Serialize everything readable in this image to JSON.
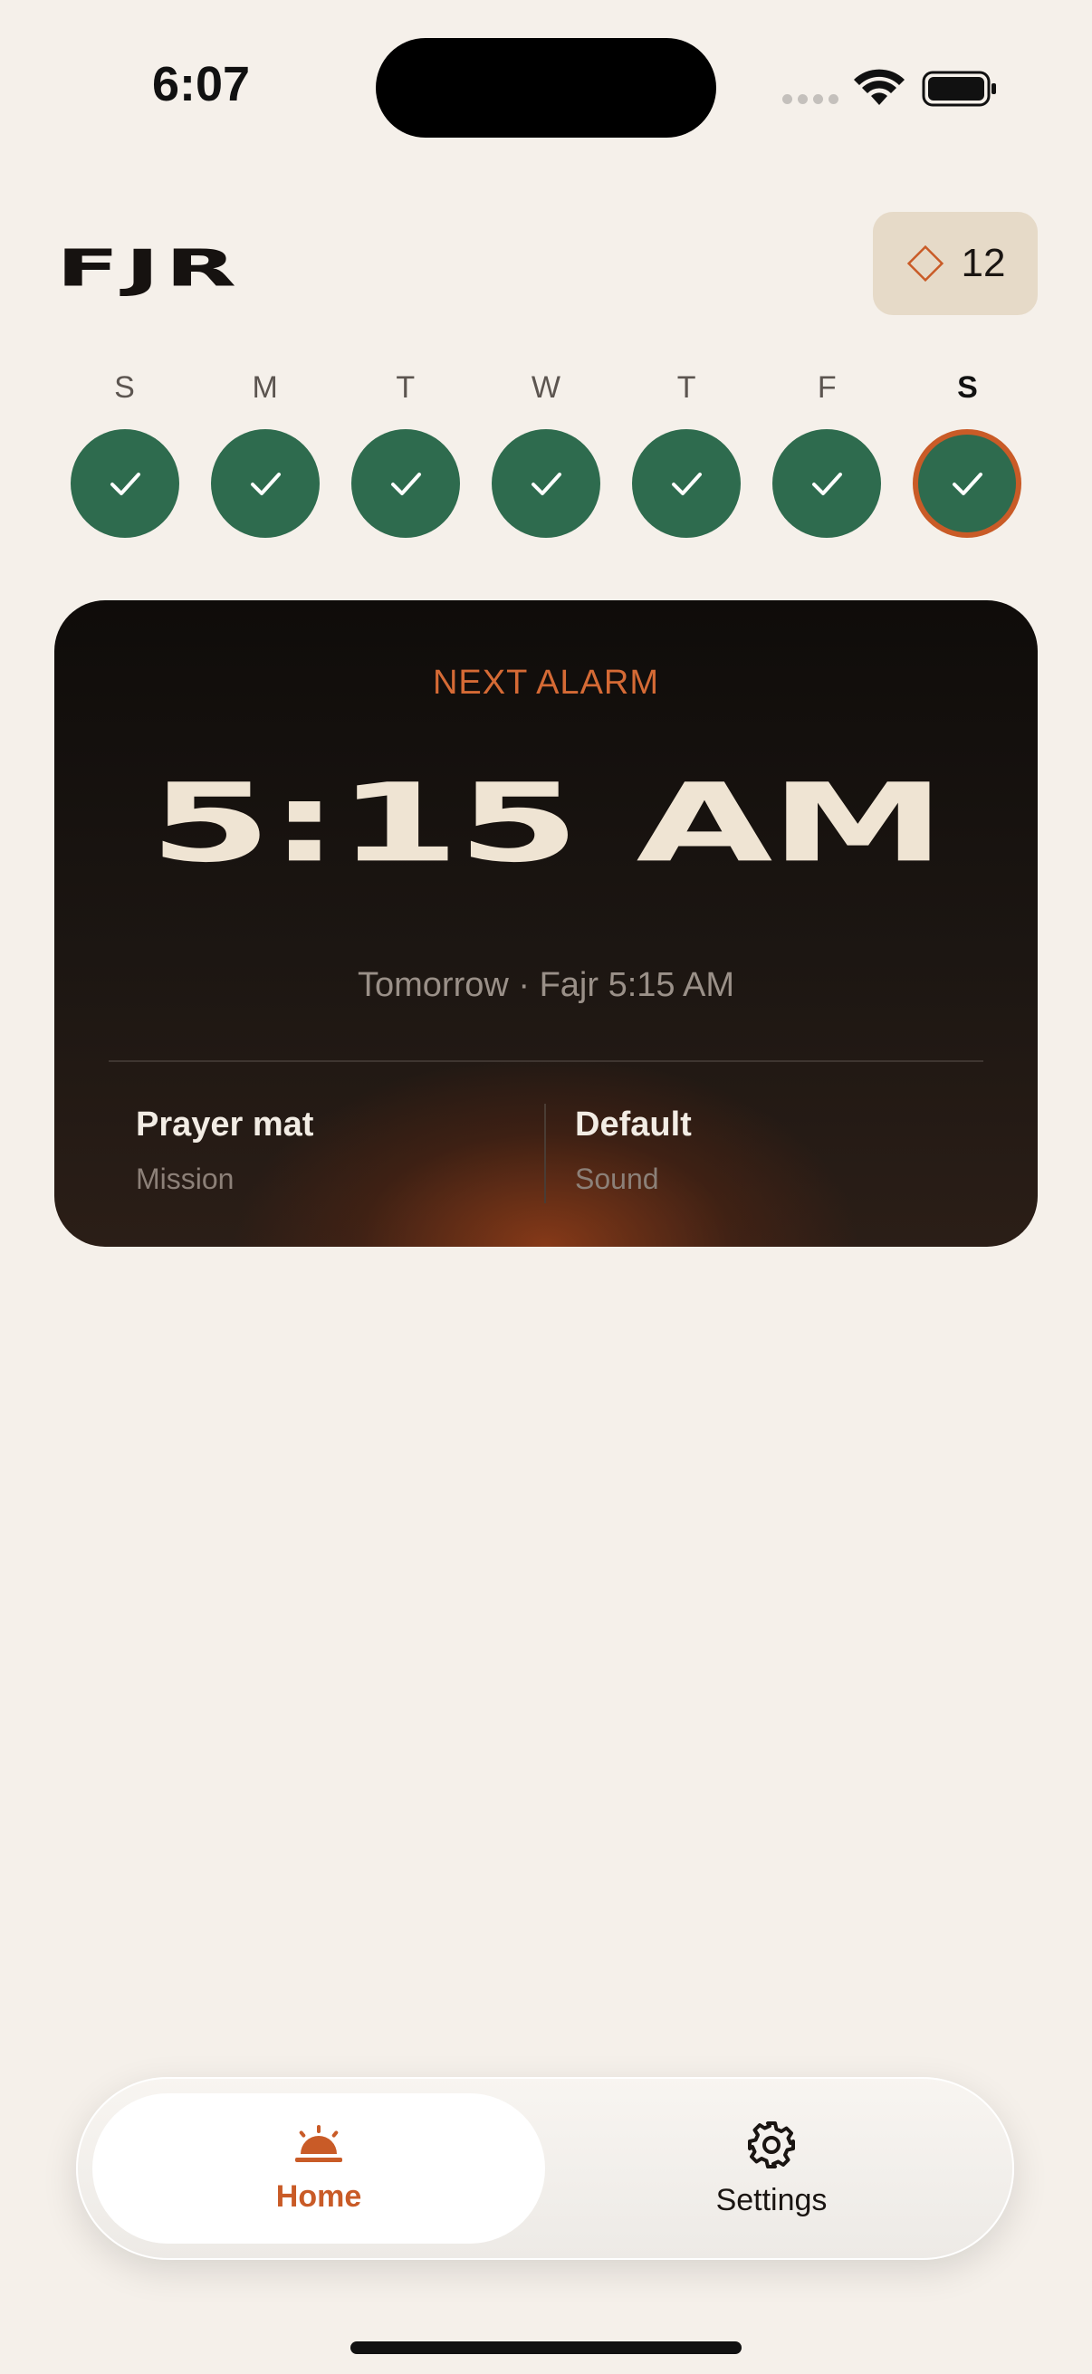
{
  "status_bar": {
    "time": "6:07"
  },
  "header": {
    "logo": "FJR",
    "streak_count": "12"
  },
  "week": {
    "days": [
      {
        "letter": "S",
        "done": true,
        "today": false
      },
      {
        "letter": "M",
        "done": true,
        "today": false
      },
      {
        "letter": "T",
        "done": true,
        "today": false
      },
      {
        "letter": "W",
        "done": true,
        "today": false
      },
      {
        "letter": "T",
        "done": true,
        "today": false
      },
      {
        "letter": "F",
        "done": true,
        "today": false
      },
      {
        "letter": "S",
        "done": true,
        "today": true
      }
    ]
  },
  "alarm": {
    "label": "NEXT ALARM",
    "time": "5:15 AM",
    "subtitle": "Tomorrow · Fajr 5:15 AM",
    "mission": {
      "value": "Prayer mat",
      "caption": "Mission"
    },
    "sound": {
      "value": "Default",
      "caption": "Sound"
    }
  },
  "tabbar": {
    "home_label": "Home",
    "settings_label": "Settings",
    "active": "home"
  },
  "colors": {
    "background": "#F5F0EA",
    "accent": "#C95B27",
    "success": "#2E6B4E",
    "card_text": "#EFE4D3"
  }
}
